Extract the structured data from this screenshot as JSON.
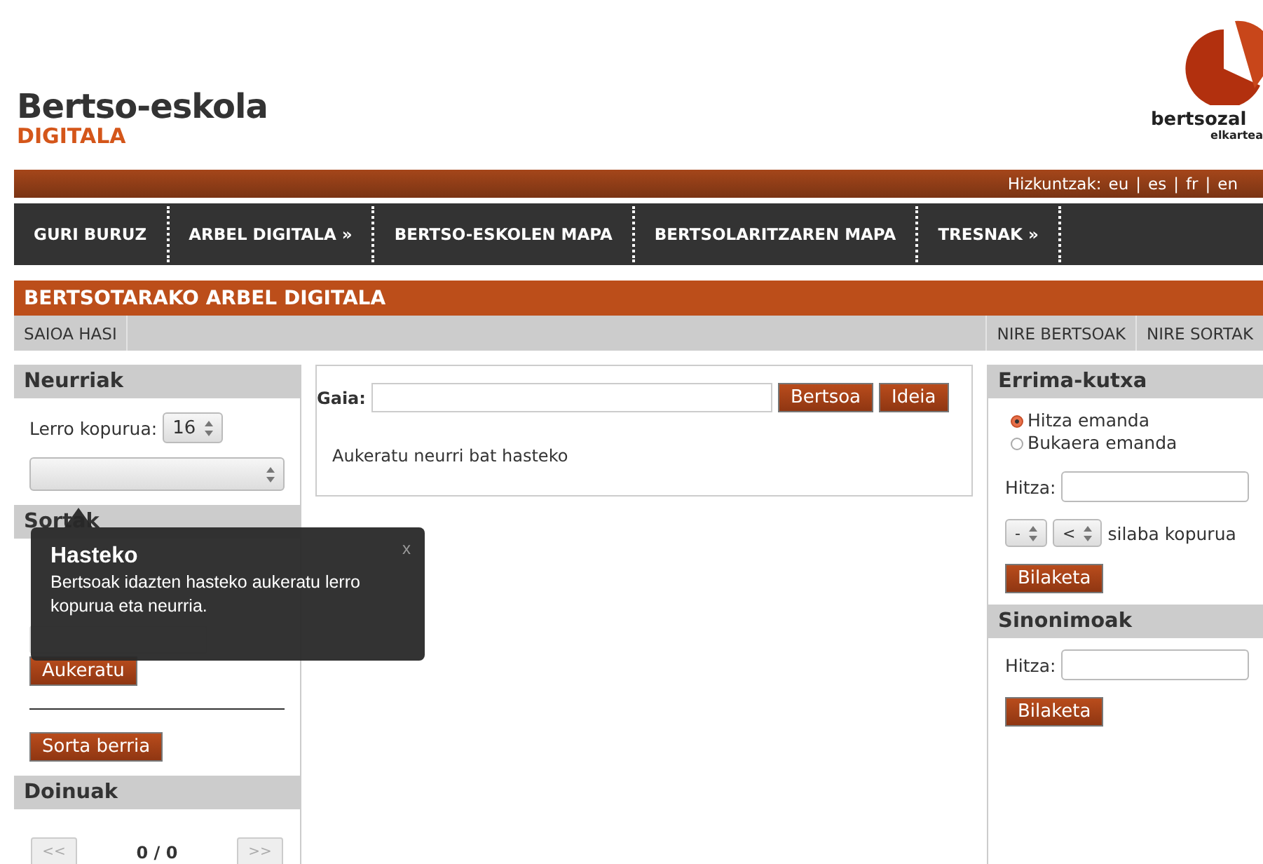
{
  "header": {
    "logo_title": "Bertso-eskola",
    "logo_subtitle": "DIGITALA",
    "partner_name": "bertsozal",
    "partner_sub": "elkartea"
  },
  "language_bar": {
    "label": "Hizkuntzak:",
    "separator": "|",
    "languages": [
      {
        "code": "eu"
      },
      {
        "code": "es"
      },
      {
        "code": "fr"
      },
      {
        "code": "en"
      }
    ]
  },
  "nav": {
    "items": [
      {
        "label": "GURI BURUZ"
      },
      {
        "label": "ARBEL DIGITALA »"
      },
      {
        "label": "BERTSO-ESKOLEN MAPA"
      },
      {
        "label": "BERTSOLARITZAREN MAPA"
      },
      {
        "label": "TRESNAK »"
      }
    ]
  },
  "page_title": "BERTSOTARAKO ARBEL DIGITALA",
  "sub_bar": {
    "left": [
      "SAIOA HASI"
    ],
    "right": [
      "NIRE BERTSOAK",
      "NIRE SORTAK"
    ]
  },
  "left_column": {
    "neurriak": {
      "title": "Neurriak",
      "line_count_label": "Lerro kopurua:",
      "line_count_value": "16"
    },
    "sortak": {
      "title": "Sortak",
      "choose_button": "Aukeratu",
      "new_button": "Sorta berria"
    },
    "doinuak": {
      "title": "Doinuak",
      "prev": {
        "label": "<<",
        "disabled": true
      },
      "counter": "0 / 0",
      "next": {
        "label": ">>",
        "disabled": true
      }
    }
  },
  "main": {
    "topic_label": "Gaia:",
    "buttons": [
      "Bertsoa",
      "Ideia"
    ],
    "message": "Aukeratu neurri bat hasteko"
  },
  "right_column": {
    "errima": {
      "title": "Errima-kutxa",
      "modes": [
        {
          "label": "Hitza emanda",
          "selected": true
        },
        {
          "label": "Bukaera emanda",
          "selected": false
        }
      ],
      "word_label": "Hitza:",
      "syllable_selects": [
        "-",
        "<"
      ],
      "syllable_label": "silaba kopurua",
      "search_button": "Bilaketa"
    },
    "sinonimoak": {
      "title": "Sinonimoak",
      "word_label": "Hitza:",
      "search_button": "Bilaketa"
    }
  },
  "tooltip": {
    "title": "Hasteko",
    "text": "Bertsoak idazten hasteko aukeratu lerro kopurua eta neurria.",
    "close": "x"
  }
}
